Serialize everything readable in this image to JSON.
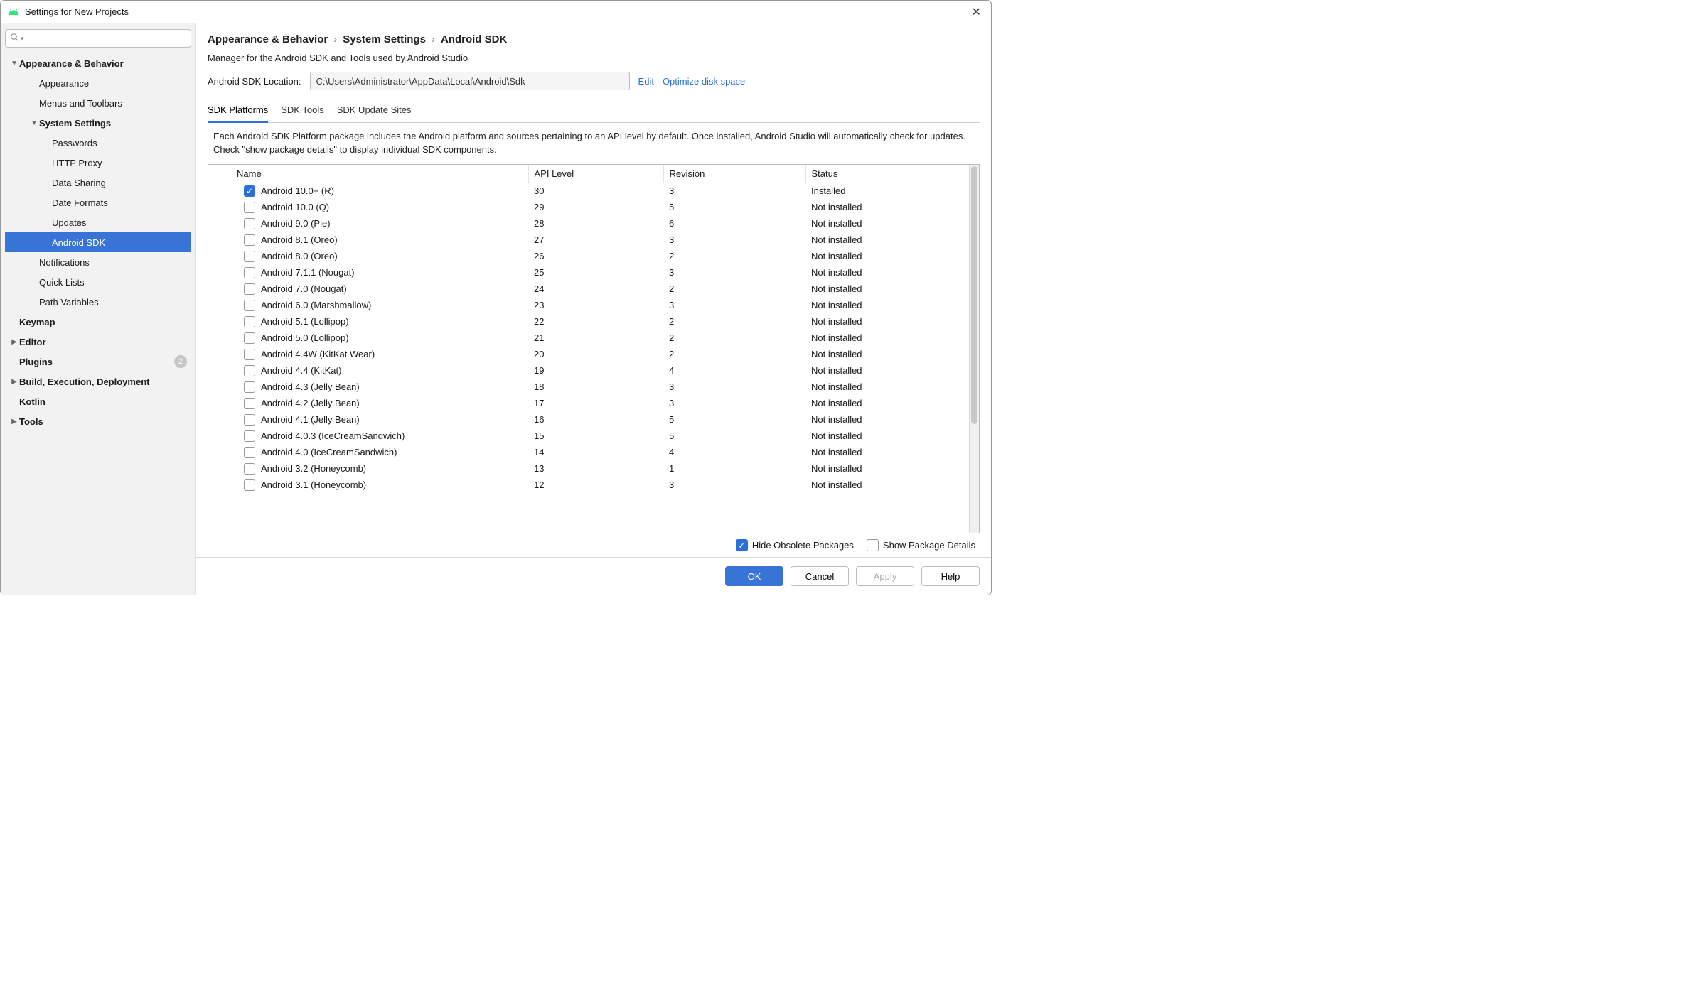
{
  "window": {
    "title": "Settings for New Projects"
  },
  "sidebar": {
    "items": [
      {
        "label": "Appearance & Behavior",
        "bold": true,
        "expandable": true,
        "expanded": true,
        "indent": 0
      },
      {
        "label": "Appearance",
        "indent": 1
      },
      {
        "label": "Menus and Toolbars",
        "indent": 1
      },
      {
        "label": "System Settings",
        "bold": true,
        "expandable": true,
        "expanded": true,
        "indent": 1
      },
      {
        "label": "Passwords",
        "indent": 2
      },
      {
        "label": "HTTP Proxy",
        "indent": 2
      },
      {
        "label": "Data Sharing",
        "indent": 2
      },
      {
        "label": "Date Formats",
        "indent": 2
      },
      {
        "label": "Updates",
        "indent": 2
      },
      {
        "label": "Android SDK",
        "indent": 2,
        "selected": true
      },
      {
        "label": "Notifications",
        "indent": 1
      },
      {
        "label": "Quick Lists",
        "indent": 1
      },
      {
        "label": "Path Variables",
        "indent": 1
      },
      {
        "label": "Keymap",
        "bold": true,
        "indent": 0
      },
      {
        "label": "Editor",
        "bold": true,
        "expandable": true,
        "expanded": false,
        "indent": 0
      },
      {
        "label": "Plugins",
        "bold": true,
        "indent": 0,
        "badge": "2"
      },
      {
        "label": "Build, Execution, Deployment",
        "bold": true,
        "expandable": true,
        "expanded": false,
        "indent": 0
      },
      {
        "label": "Kotlin",
        "bold": true,
        "indent": 0
      },
      {
        "label": "Tools",
        "bold": true,
        "expandable": true,
        "expanded": false,
        "indent": 0
      }
    ]
  },
  "breadcrumb": {
    "a": "Appearance & Behavior",
    "b": "System Settings",
    "c": "Android SDK",
    "sep": "›"
  },
  "description": "Manager for the Android SDK and Tools used by Android Studio",
  "location": {
    "label": "Android SDK Location:",
    "value": "C:\\Users\\Administrator\\AppData\\Local\\Android\\Sdk",
    "edit": "Edit",
    "optimize": "Optimize disk space"
  },
  "tabs": {
    "t0": "SDK Platforms",
    "t1": "SDK Tools",
    "t2": "SDK Update Sites"
  },
  "tabdesc": "Each Android SDK Platform package includes the Android platform and sources pertaining to an API level by default. Once installed, Android Studio will automatically check for updates. Check \"show package details\" to display individual SDK components.",
  "columns": {
    "name": "Name",
    "api": "API Level",
    "rev": "Revision",
    "status": "Status"
  },
  "rows": [
    {
      "checked": true,
      "name": "Android 10.0+ (R)",
      "api": "30",
      "rev": "3",
      "status": "Installed"
    },
    {
      "checked": false,
      "name": "Android 10.0 (Q)",
      "api": "29",
      "rev": "5",
      "status": "Not installed"
    },
    {
      "checked": false,
      "name": "Android 9.0 (Pie)",
      "api": "28",
      "rev": "6",
      "status": "Not installed"
    },
    {
      "checked": false,
      "name": "Android 8.1 (Oreo)",
      "api": "27",
      "rev": "3",
      "status": "Not installed"
    },
    {
      "checked": false,
      "name": "Android 8.0 (Oreo)",
      "api": "26",
      "rev": "2",
      "status": "Not installed"
    },
    {
      "checked": false,
      "name": "Android 7.1.1 (Nougat)",
      "api": "25",
      "rev": "3",
      "status": "Not installed"
    },
    {
      "checked": false,
      "name": "Android 7.0 (Nougat)",
      "api": "24",
      "rev": "2",
      "status": "Not installed"
    },
    {
      "checked": false,
      "name": "Android 6.0 (Marshmallow)",
      "api": "23",
      "rev": "3",
      "status": "Not installed"
    },
    {
      "checked": false,
      "name": "Android 5.1 (Lollipop)",
      "api": "22",
      "rev": "2",
      "status": "Not installed"
    },
    {
      "checked": false,
      "name": "Android 5.0 (Lollipop)",
      "api": "21",
      "rev": "2",
      "status": "Not installed"
    },
    {
      "checked": false,
      "name": "Android 4.4W (KitKat Wear)",
      "api": "20",
      "rev": "2",
      "status": "Not installed"
    },
    {
      "checked": false,
      "name": "Android 4.4 (KitKat)",
      "api": "19",
      "rev": "4",
      "status": "Not installed"
    },
    {
      "checked": false,
      "name": "Android 4.3 (Jelly Bean)",
      "api": "18",
      "rev": "3",
      "status": "Not installed"
    },
    {
      "checked": false,
      "name": "Android 4.2 (Jelly Bean)",
      "api": "17",
      "rev": "3",
      "status": "Not installed"
    },
    {
      "checked": false,
      "name": "Android 4.1 (Jelly Bean)",
      "api": "16",
      "rev": "5",
      "status": "Not installed"
    },
    {
      "checked": false,
      "name": "Android 4.0.3 (IceCreamSandwich)",
      "api": "15",
      "rev": "5",
      "status": "Not installed"
    },
    {
      "checked": false,
      "name": "Android 4.0 (IceCreamSandwich)",
      "api": "14",
      "rev": "4",
      "status": "Not installed"
    },
    {
      "checked": false,
      "name": "Android 3.2 (Honeycomb)",
      "api": "13",
      "rev": "1",
      "status": "Not installed"
    },
    {
      "checked": false,
      "name": "Android 3.1 (Honeycomb)",
      "api": "12",
      "rev": "3",
      "status": "Not installed"
    }
  ],
  "bottom": {
    "hide": "Hide Obsolete Packages",
    "show": "Show Package Details"
  },
  "footer": {
    "ok": "OK",
    "cancel": "Cancel",
    "apply": "Apply",
    "help": "Help"
  }
}
